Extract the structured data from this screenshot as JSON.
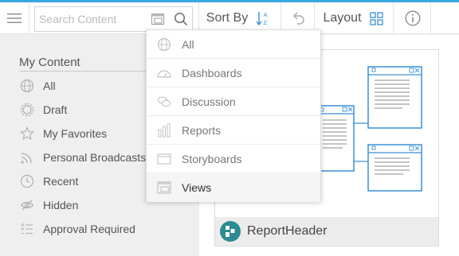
{
  "toolbar": {
    "search_placeholder": "Search Content",
    "sort_label": "Sort By",
    "layout_label": "Layout"
  },
  "sidebar": {
    "heading": "My Content",
    "items": [
      {
        "label": "All",
        "icon": "globe-icon"
      },
      {
        "label": "Draft",
        "icon": "draft-gear-icon"
      },
      {
        "label": "My Favorites",
        "icon": "star-icon"
      },
      {
        "label": "Personal Broadcasts",
        "icon": "broadcast-icon"
      },
      {
        "label": "Recent",
        "icon": "clock-icon"
      },
      {
        "label": "Hidden",
        "icon": "eye-off-icon"
      },
      {
        "label": "Approval Required",
        "icon": "checklist-icon"
      }
    ]
  },
  "filter_menu": {
    "items": [
      {
        "label": "All",
        "icon": "globe-icon"
      },
      {
        "label": "Dashboards",
        "icon": "dashboard-gauge-icon"
      },
      {
        "label": "Discussion",
        "icon": "discussion-icon"
      },
      {
        "label": "Reports",
        "icon": "bar-chart-icon"
      },
      {
        "label": "Storyboards",
        "icon": "storyboard-icon"
      },
      {
        "label": "Views",
        "icon": "views-icon"
      }
    ],
    "selected": "Views"
  },
  "content": {
    "card_title": "ReportHeader"
  },
  "colors": {
    "accent": "#3ba7e0",
    "icon_blue": "#3a8fd6",
    "card_logo": "#2b8a92"
  }
}
